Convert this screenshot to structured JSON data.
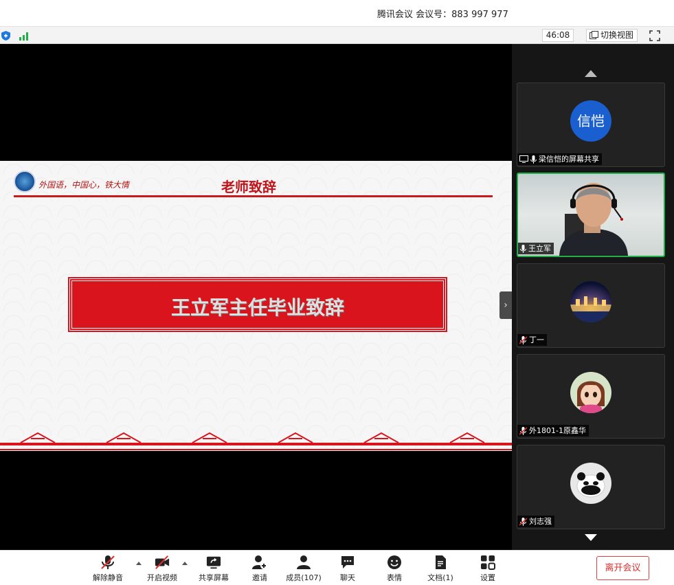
{
  "window": {
    "title": "腾讯会议 会议号：883 997 977"
  },
  "status_bar": {
    "timer": "46:08",
    "switch_view_label": "切换视图",
    "shield_icon": "shield-icon",
    "signal_icon": "signal-icon",
    "fullscreen_icon": "fullscreen-icon"
  },
  "slide": {
    "motto": "外国语，中国心，铁大情",
    "title": "老师致辞",
    "banner_text": "王立军主任毕业致辞"
  },
  "participants": [
    {
      "name": "梁信恺的屏幕共享",
      "avatar_text": "信恺",
      "mic": "on",
      "screen_share": true
    },
    {
      "name": "王立军",
      "mic": "on",
      "video": true,
      "active": true
    },
    {
      "name": "丁一",
      "mic": "muted"
    },
    {
      "name": "外1801-1原鑫华",
      "mic": "muted"
    },
    {
      "name": "刘志强",
      "mic": "muted"
    }
  ],
  "toolbar": {
    "unmute": "解除静音",
    "start_video": "开启视频",
    "share_screen": "共享屏幕",
    "invite": "邀请",
    "members": "成员(107)",
    "chat": "聊天",
    "reactions": "表情",
    "docs": "文档(1)",
    "settings": "设置",
    "leave": "离开会议"
  },
  "colors": {
    "accent_red": "#d9141c",
    "active_green": "#20b04a",
    "avatar_blue": "#1a5fcf",
    "leave_red": "#e03030"
  }
}
